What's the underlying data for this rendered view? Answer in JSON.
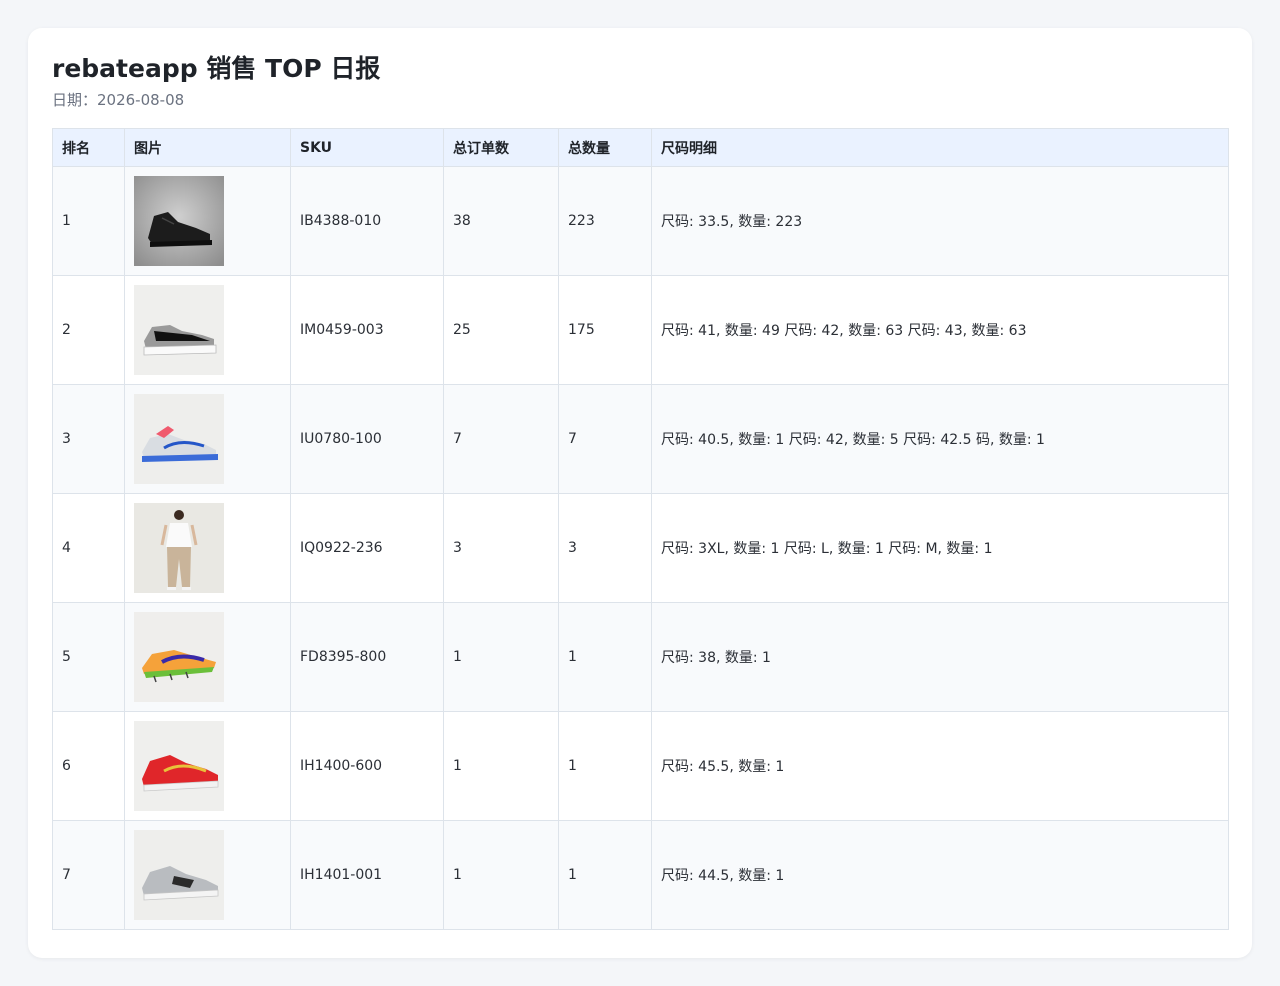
{
  "report": {
    "title": "rebateapp 销售 TOP 日报",
    "date_label": "日期：2026-08-08"
  },
  "table": {
    "headers": [
      "排名",
      "图片",
      "SKU",
      "总订单数",
      "总数量",
      "尺码明细"
    ],
    "rows": [
      {
        "rank": "1",
        "image": "black-sneaker-image",
        "sku": "IB4388-010",
        "orders": "38",
        "qty": "223",
        "sizes": "尺码: 33.5, 数量: 223"
      },
      {
        "rank": "2",
        "image": "black-white-grey-sneaker-image",
        "sku": "IM0459-003",
        "orders": "25",
        "qty": "175",
        "sizes": "尺码: 41, 数量: 49 尺码: 42, 数量: 63 尺码: 43, 数量: 63"
      },
      {
        "rank": "3",
        "image": "white-blue-pink-running-shoe-image",
        "sku": "IU0780-100",
        "orders": "7",
        "qty": "7",
        "sizes": "尺码: 40.5, 数量: 1 尺码: 42, 数量: 5 尺码: 42.5 码, 数量: 1"
      },
      {
        "rank": "4",
        "image": "apparel-model-image",
        "sku": "IQ0922-236",
        "orders": "3",
        "qty": "3",
        "sizes": "尺码: 3XL, 数量: 1 尺码: L, 数量: 1 尺码: M, 数量: 1"
      },
      {
        "rank": "5",
        "image": "orange-spike-shoe-image",
        "sku": "FD8395-800",
        "orders": "1",
        "qty": "1",
        "sizes": "尺码: 38, 数量: 1"
      },
      {
        "rank": "6",
        "image": "red-basketball-shoe-image",
        "sku": "IH1400-600",
        "orders": "1",
        "qty": "1",
        "sizes": "尺码: 45.5, 数量: 1"
      },
      {
        "rank": "7",
        "image": "grey-basketball-shoe-image",
        "sku": "IH1401-001",
        "orders": "1",
        "qty": "1",
        "sizes": "尺码: 44.5, 数量: 1"
      }
    ]
  }
}
